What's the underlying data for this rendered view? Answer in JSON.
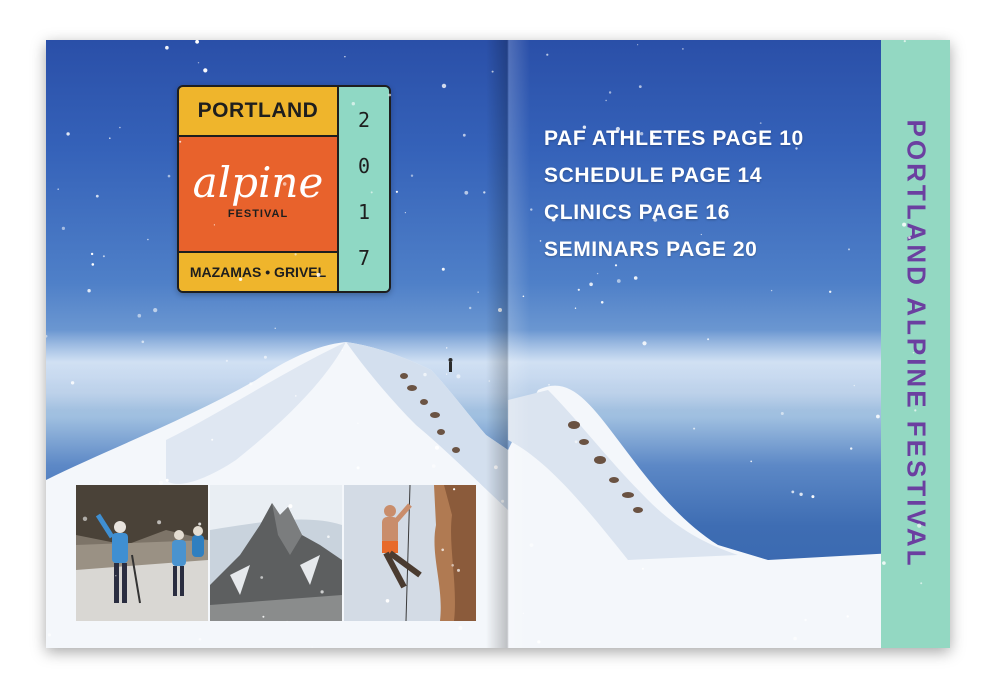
{
  "logo": {
    "top_text": "PORTLAND",
    "script_text": "alpine",
    "festival_text": "FESTIVAL",
    "bottom_text": "MAZAMAS • GRIVEL",
    "year_digits": [
      "2",
      "0",
      "1",
      "7"
    ]
  },
  "photos": [
    {
      "icon": "climbers-photo"
    },
    {
      "icon": "mountain-peak-photo"
    },
    {
      "icon": "rock-climber-photo"
    }
  ],
  "toc": {
    "items": [
      {
        "label": "PAF ATHLETES PAGE 10"
      },
      {
        "label": "SCHEDULE PAGE 14"
      },
      {
        "label": "CLINICS PAGE 16"
      },
      {
        "label": "SEMINARS PAGE 20"
      }
    ]
  },
  "sidebar": {
    "title": "PORTLAND ALPINE FESTIVAL"
  },
  "colors": {
    "logo_yellow": "#efb52c",
    "logo_orange": "#e8622c",
    "logo_teal": "#8fd8c4",
    "sidebar_teal": "#93d8c2",
    "sidebar_text": "#6b3fa0"
  }
}
